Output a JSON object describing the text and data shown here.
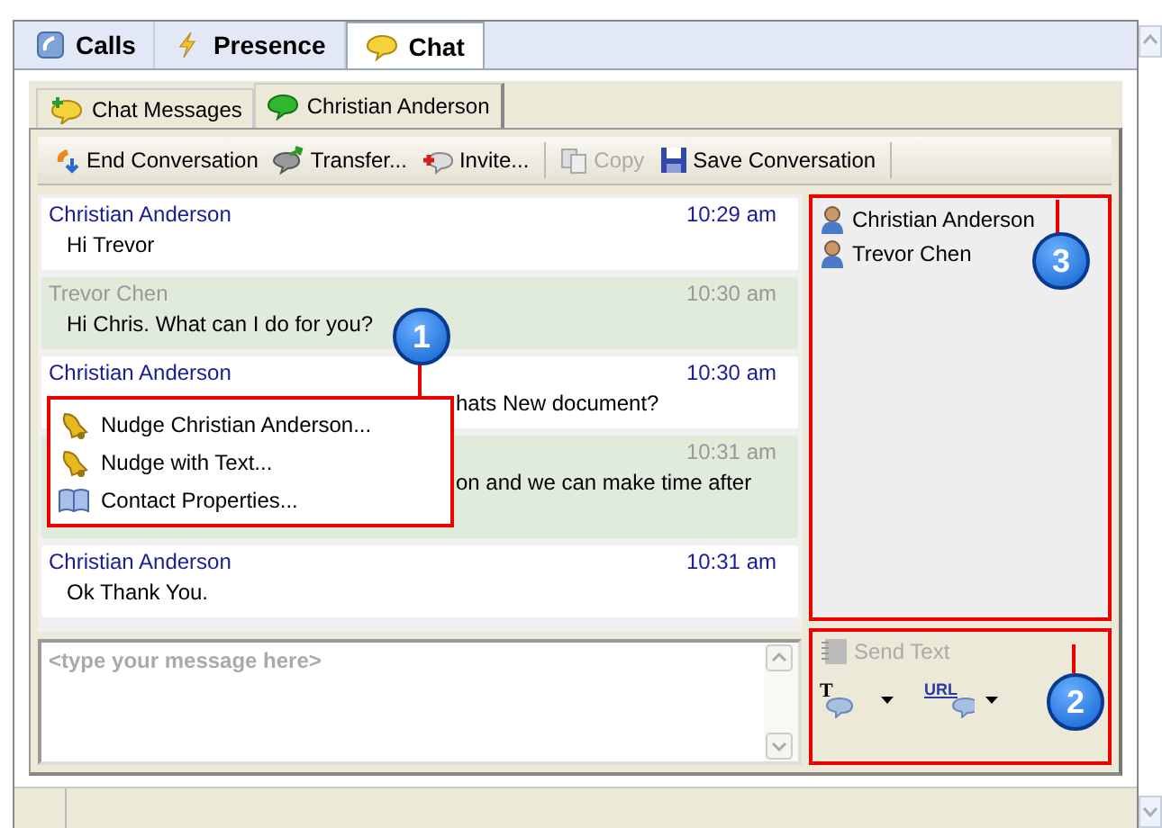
{
  "main_tabs": [
    {
      "label": "Calls",
      "selected": false
    },
    {
      "label": "Presence",
      "selected": false
    },
    {
      "label": "Chat",
      "selected": true
    }
  ],
  "chat_tabs": [
    {
      "label": "Chat Messages",
      "selected": false
    },
    {
      "label": "Christian Anderson",
      "selected": true
    }
  ],
  "toolbar": [
    {
      "label": "End Conversation",
      "disabled": false
    },
    {
      "label": "Transfer...",
      "disabled": false
    },
    {
      "label": "Invite...",
      "disabled": false
    },
    {
      "label": "Copy",
      "disabled": true
    },
    {
      "label": "Save Conversation",
      "disabled": false
    }
  ],
  "messages": [
    {
      "sender": "Christian Anderson",
      "time": "10:29 am",
      "text": "Hi Trevor",
      "kind": "self",
      "covered": false
    },
    {
      "sender": "Trevor Chen",
      "time": "10:30 am",
      "text": "Hi Chris. What can I do for you?",
      "kind": "other",
      "covered": false
    },
    {
      "sender": "Christian Anderson",
      "time": "10:30 am",
      "text": "hats New document?",
      "kind": "self",
      "covered": true
    },
    {
      "time": "10:31 am",
      "text": "on and we can make time after",
      "kind": "other",
      "covered": true
    },
    {
      "sender": "Christian Anderson",
      "time": "10:31 am",
      "text": "Ok Thank You.",
      "kind": "self",
      "covered": false
    }
  ],
  "context_menu": [
    "Nudge Christian Anderson...",
    "Nudge with Text...",
    "Contact Properties..."
  ],
  "participants": [
    "Christian Anderson",
    "Trevor Chen"
  ],
  "message_input": {
    "placeholder": "<type your message here>"
  },
  "send": {
    "label": "Send Text",
    "disabled": true
  },
  "format_buttons": [
    "T",
    "URL"
  ],
  "callouts": [
    "1",
    "2",
    "3"
  ]
}
